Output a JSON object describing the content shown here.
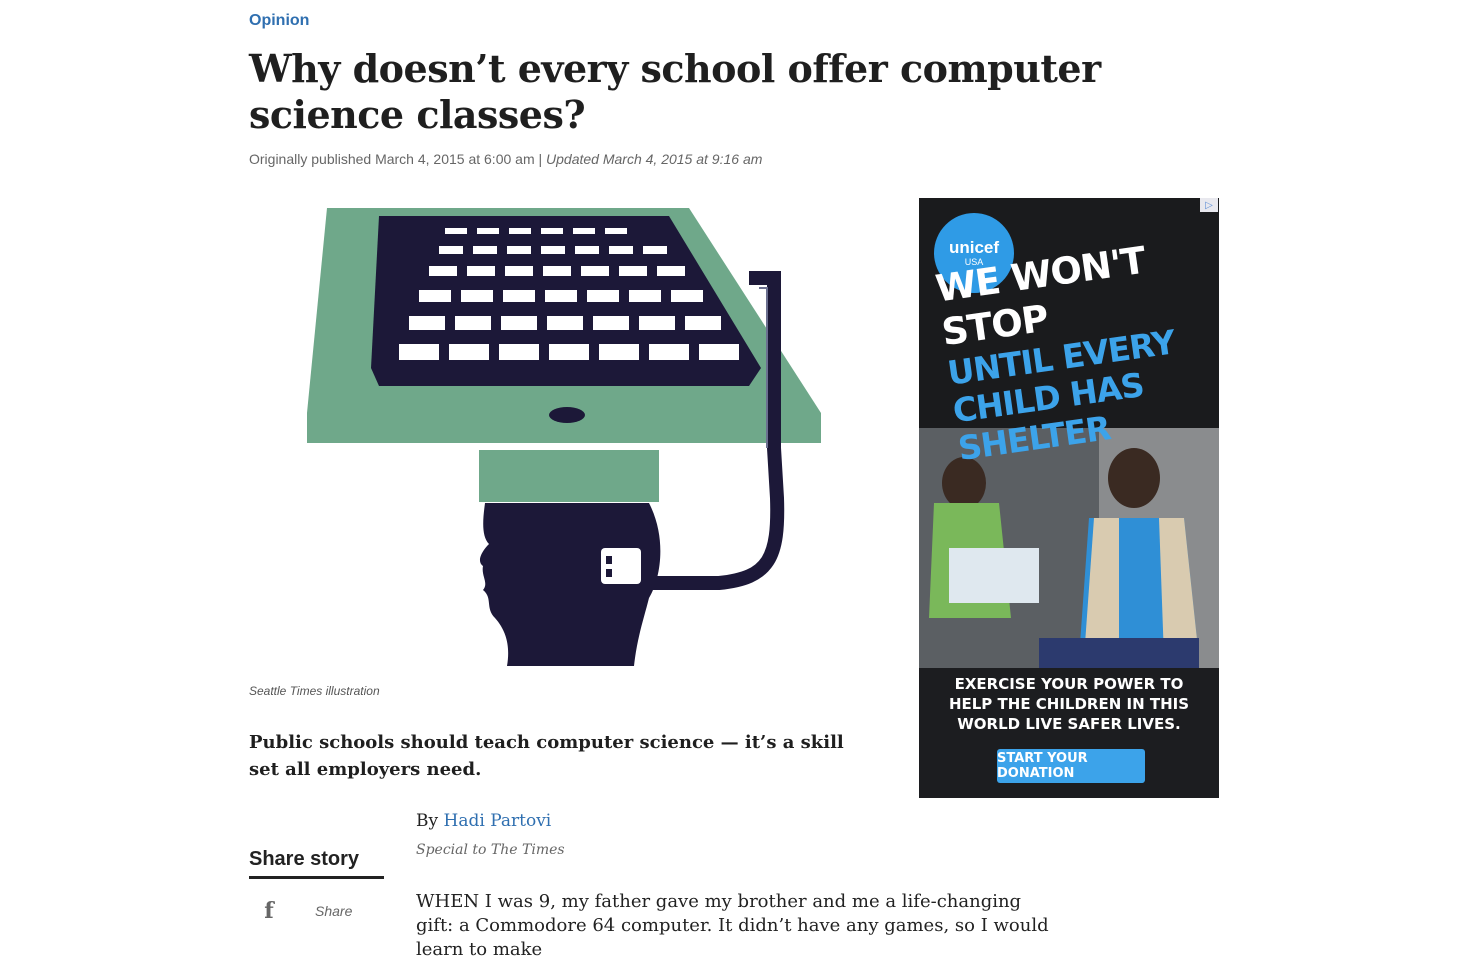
{
  "section": {
    "label": "Opinion"
  },
  "article": {
    "headline": "Why doesn’t every school offer computer science classes?",
    "published": "Originally published March 4, 2015 at 6:00 am",
    "separator": "|",
    "updated": "Updated March 4, 2015 at 9:16 am",
    "image_caption": "Seattle Times illustration",
    "dek": "Public schools should teach computer science — it’s a skill set all employers need.",
    "byline_prefix": "By",
    "author": "Hadi Partovi",
    "author_affiliation": "Special to The Times",
    "body_first_paragraph": "WHEN I was 9, my father gave my brother and me a life-changing gift: a Commodore 64 computer. It didn’t have any games, so I would learn to make"
  },
  "share": {
    "title": "Share story",
    "facebook_label": "Share",
    "facebook_icon": "facebook-icon"
  },
  "ad": {
    "logo": "unicef",
    "logo_sub": "USA",
    "headline_1": "WE WON'T STOP",
    "headline_2": "UNTIL EVERY CHILD HAS SHELTER",
    "body": "EXERCISE YOUR POWER TO HELP THE CHILDREN IN THIS WORLD LIVE SAFER LIVES.",
    "cta": "START YOUR DONATION",
    "ad_choices_icon": "ad-choices-icon",
    "accent_color": "#3ca3ea"
  },
  "colors": {
    "link": "#2f6fb0",
    "illustration_green": "#6fa88a",
    "illustration_navy": "#1c1838"
  }
}
